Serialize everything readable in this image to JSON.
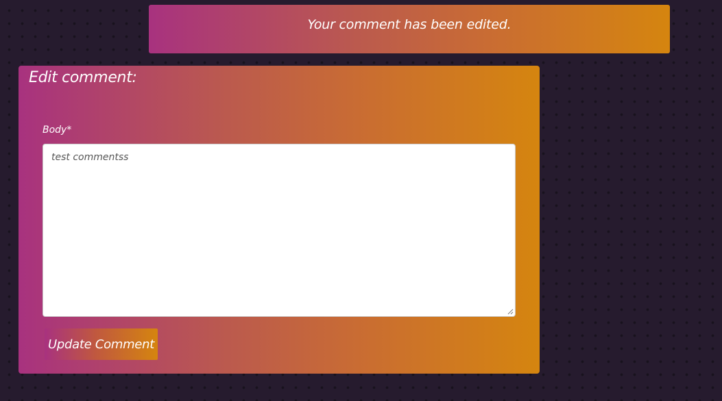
{
  "alert": {
    "message": "Your comment has been edited."
  },
  "form": {
    "title": "Edit comment:",
    "body_label": "Body*",
    "body_value": "test commentss",
    "submit_label": "Update Comment"
  },
  "colors": {
    "page_background": "#261b2e",
    "gradient_start": "#a8327f",
    "gradient_end": "#d5850f",
    "text": "#ffffff"
  },
  "icons": {
    "resize_handle": "resize-grip-icon"
  }
}
